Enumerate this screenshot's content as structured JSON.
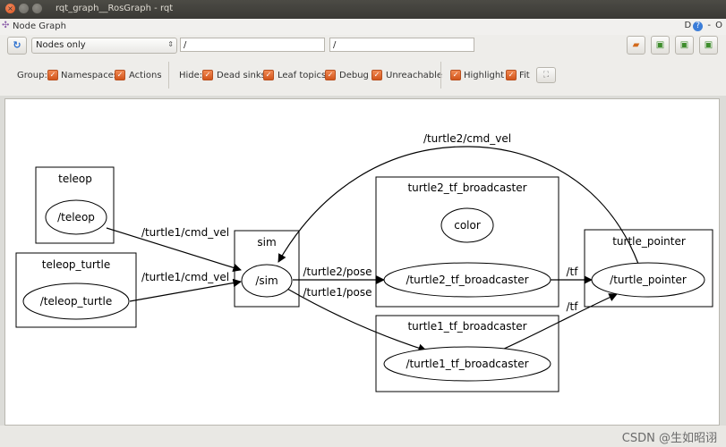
{
  "window": {
    "title": "rqt_graph__RosGraph - rqt"
  },
  "plugin": {
    "title": "Node Graph",
    "ctrl_d": "D",
    "ctrl_help": "?",
    "ctrl_minus": "-",
    "ctrl_close": "O"
  },
  "toolbar": {
    "mode_selected": "Nodes only",
    "ns_filter": "/",
    "topic_filter": "/"
  },
  "options": {
    "group_label": "Group:",
    "namespaces": "Namespaces",
    "actions": "Actions",
    "hide_label": "Hide:",
    "dead_sinks": "Dead sinks",
    "leaf_topics": "Leaf topics",
    "debug": "Debug",
    "unreachable": "Unreachable",
    "highlight": "Highlight",
    "fit": "Fit"
  },
  "graph": {
    "clusters": {
      "teleop": "teleop",
      "teleop_turtle": "teleop_turtle",
      "sim": "sim",
      "turtle2_tf_broadcaster": "turtle2_tf_broadcaster",
      "turtle1_tf_broadcaster": "turtle1_tf_broadcaster",
      "turtle_pointer": "turtle_pointer"
    },
    "nodes": {
      "teleop": "/teleop",
      "teleop_turtle": "/teleop_turtle",
      "sim": "/sim",
      "color": "color",
      "turtle2_tf_broadcaster": "/turtle2_tf_broadcaster",
      "turtle1_tf_broadcaster": "/turtle1_tf_broadcaster",
      "turtle_pointer": "/turtle_pointer"
    },
    "edges": {
      "teleop_cmd": "/turtle1/cmd_vel",
      "teleop_turtle_cmd": "/turtle1/cmd_vel",
      "turtle2_pose": "/turtle2/pose",
      "turtle1_pose": "/turtle1/pose",
      "tf_top": "/tf",
      "tf_bottom": "/tf",
      "turtle2_cmd": "/turtle2/cmd_vel"
    }
  },
  "watermark": "CSDN @生如昭诩",
  "colors": {
    "checkbox": "#d2551b",
    "title_bar": "#3a3935",
    "canvas": "#ffffff"
  }
}
